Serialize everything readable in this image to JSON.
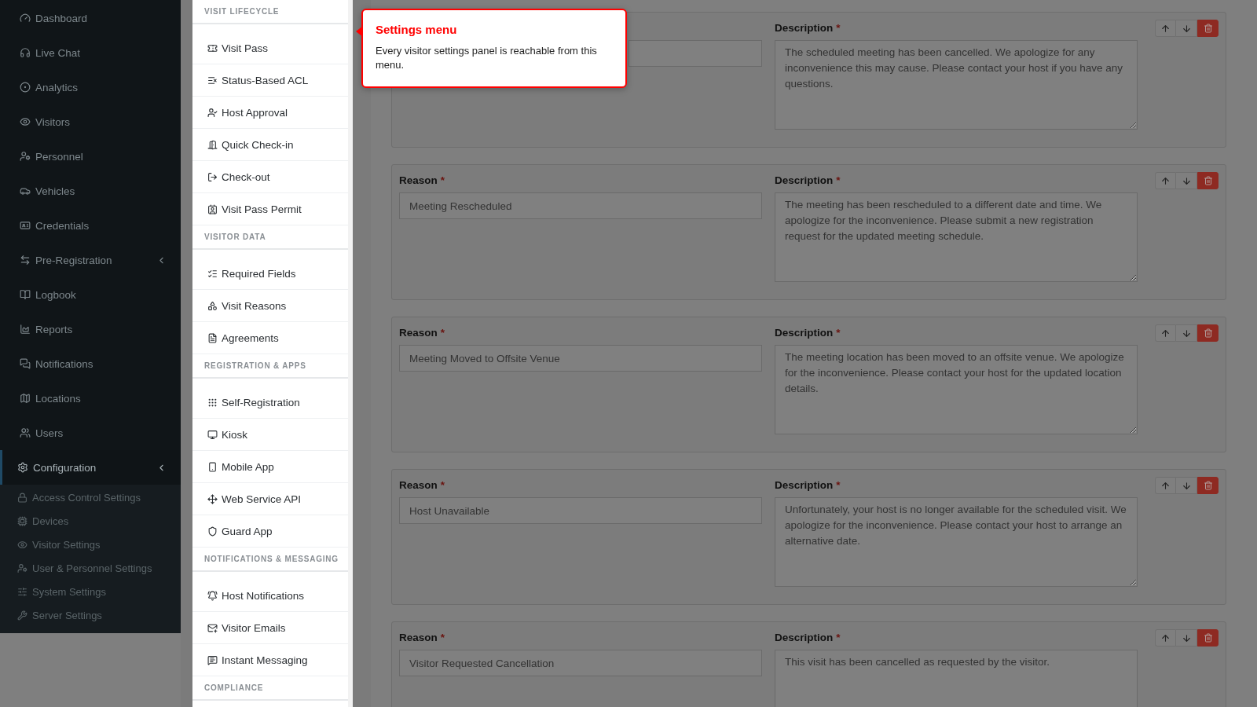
{
  "sidebar": {
    "items": [
      {
        "label": "Dashboard",
        "selected": false,
        "submenu": false
      },
      {
        "label": "Live Chat",
        "selected": false,
        "submenu": false
      },
      {
        "label": "Analytics",
        "selected": false,
        "submenu": false
      },
      {
        "label": "Visitors",
        "selected": false,
        "submenu": false
      },
      {
        "label": "Personnel",
        "selected": false,
        "submenu": false
      },
      {
        "label": "Vehicles",
        "selected": false,
        "submenu": false
      },
      {
        "label": "Credentials",
        "selected": false,
        "submenu": false
      },
      {
        "label": "Pre-Registration",
        "selected": false,
        "submenu": true
      },
      {
        "label": "Logbook",
        "selected": false,
        "submenu": false
      },
      {
        "label": "Reports",
        "selected": false,
        "submenu": false
      },
      {
        "label": "Notifications",
        "selected": false,
        "submenu": false
      },
      {
        "label": "Locations",
        "selected": false,
        "submenu": false
      },
      {
        "label": "Users",
        "selected": false,
        "submenu": false
      },
      {
        "label": "Configuration",
        "selected": true,
        "submenu": true,
        "children": [
          {
            "label": "Access Control Settings"
          },
          {
            "label": "Devices"
          },
          {
            "label": "Visitor Settings"
          },
          {
            "label": "User & Personnel Settings"
          },
          {
            "label": "System Settings"
          },
          {
            "label": "Server Settings"
          }
        ]
      }
    ]
  },
  "settings_menu": {
    "sections": [
      {
        "title": "VISIT LIFECYCLE",
        "items": [
          "Visit Pass",
          "Status-Based ACL",
          "Host Approval",
          "Quick Check-in",
          "Check-out",
          "Visit Pass Permit"
        ]
      },
      {
        "title": "VISITOR DATA",
        "items": [
          "Required Fields",
          "Visit Reasons",
          "Agreements"
        ]
      },
      {
        "title": "REGISTRATION & APPS",
        "items": [
          "Self-Registration",
          "Kiosk",
          "Mobile App",
          "Web Service API",
          "Guard App"
        ]
      },
      {
        "title": "NOTIFICATIONS & MESSAGING",
        "items": [
          "Host Notifications",
          "Visitor Emails",
          "Instant Messaging"
        ]
      },
      {
        "title": "COMPLIANCE"
      }
    ]
  },
  "tooltip": {
    "title": "Settings menu",
    "text": "Every visitor settings panel is reachable from this menu."
  },
  "reasons": [
    {
      "description_label": "Description",
      "required_mark": "*",
      "description": "The scheduled meeting has been cancelled. We apologize for any inconvenience this may cause. Please contact your host if you have any questions."
    },
    {
      "reason_label": "Reason",
      "reason": "Meeting Rescheduled",
      "description_label": "Description",
      "required_mark": "*",
      "description": "The meeting has been rescheduled to a different date and time. We apologize for the inconvenience. Please submit a new registration request for the updated meeting schedule."
    },
    {
      "reason_label": "Reason",
      "reason": "Meeting Moved to Offsite Venue",
      "description_label": "Description",
      "required_mark": "*",
      "description": "The meeting location has been moved to an offsite venue. We apologize for the inconvenience. Please contact your host for the updated location details."
    },
    {
      "reason_label": "Reason",
      "reason": "Host Unavailable",
      "description_label": "Description",
      "required_mark": "*",
      "description": "Unfortunately, your host is no longer available for the scheduled visit. We apologize for the inconvenience. Please contact your host to arrange an alternative date."
    },
    {
      "reason_label": "Reason",
      "reason": "Visitor Requested Cancellation",
      "description_label": "Description",
      "required_mark": "*",
      "description": "This visit has been cancelled as requested by the visitor."
    }
  ]
}
